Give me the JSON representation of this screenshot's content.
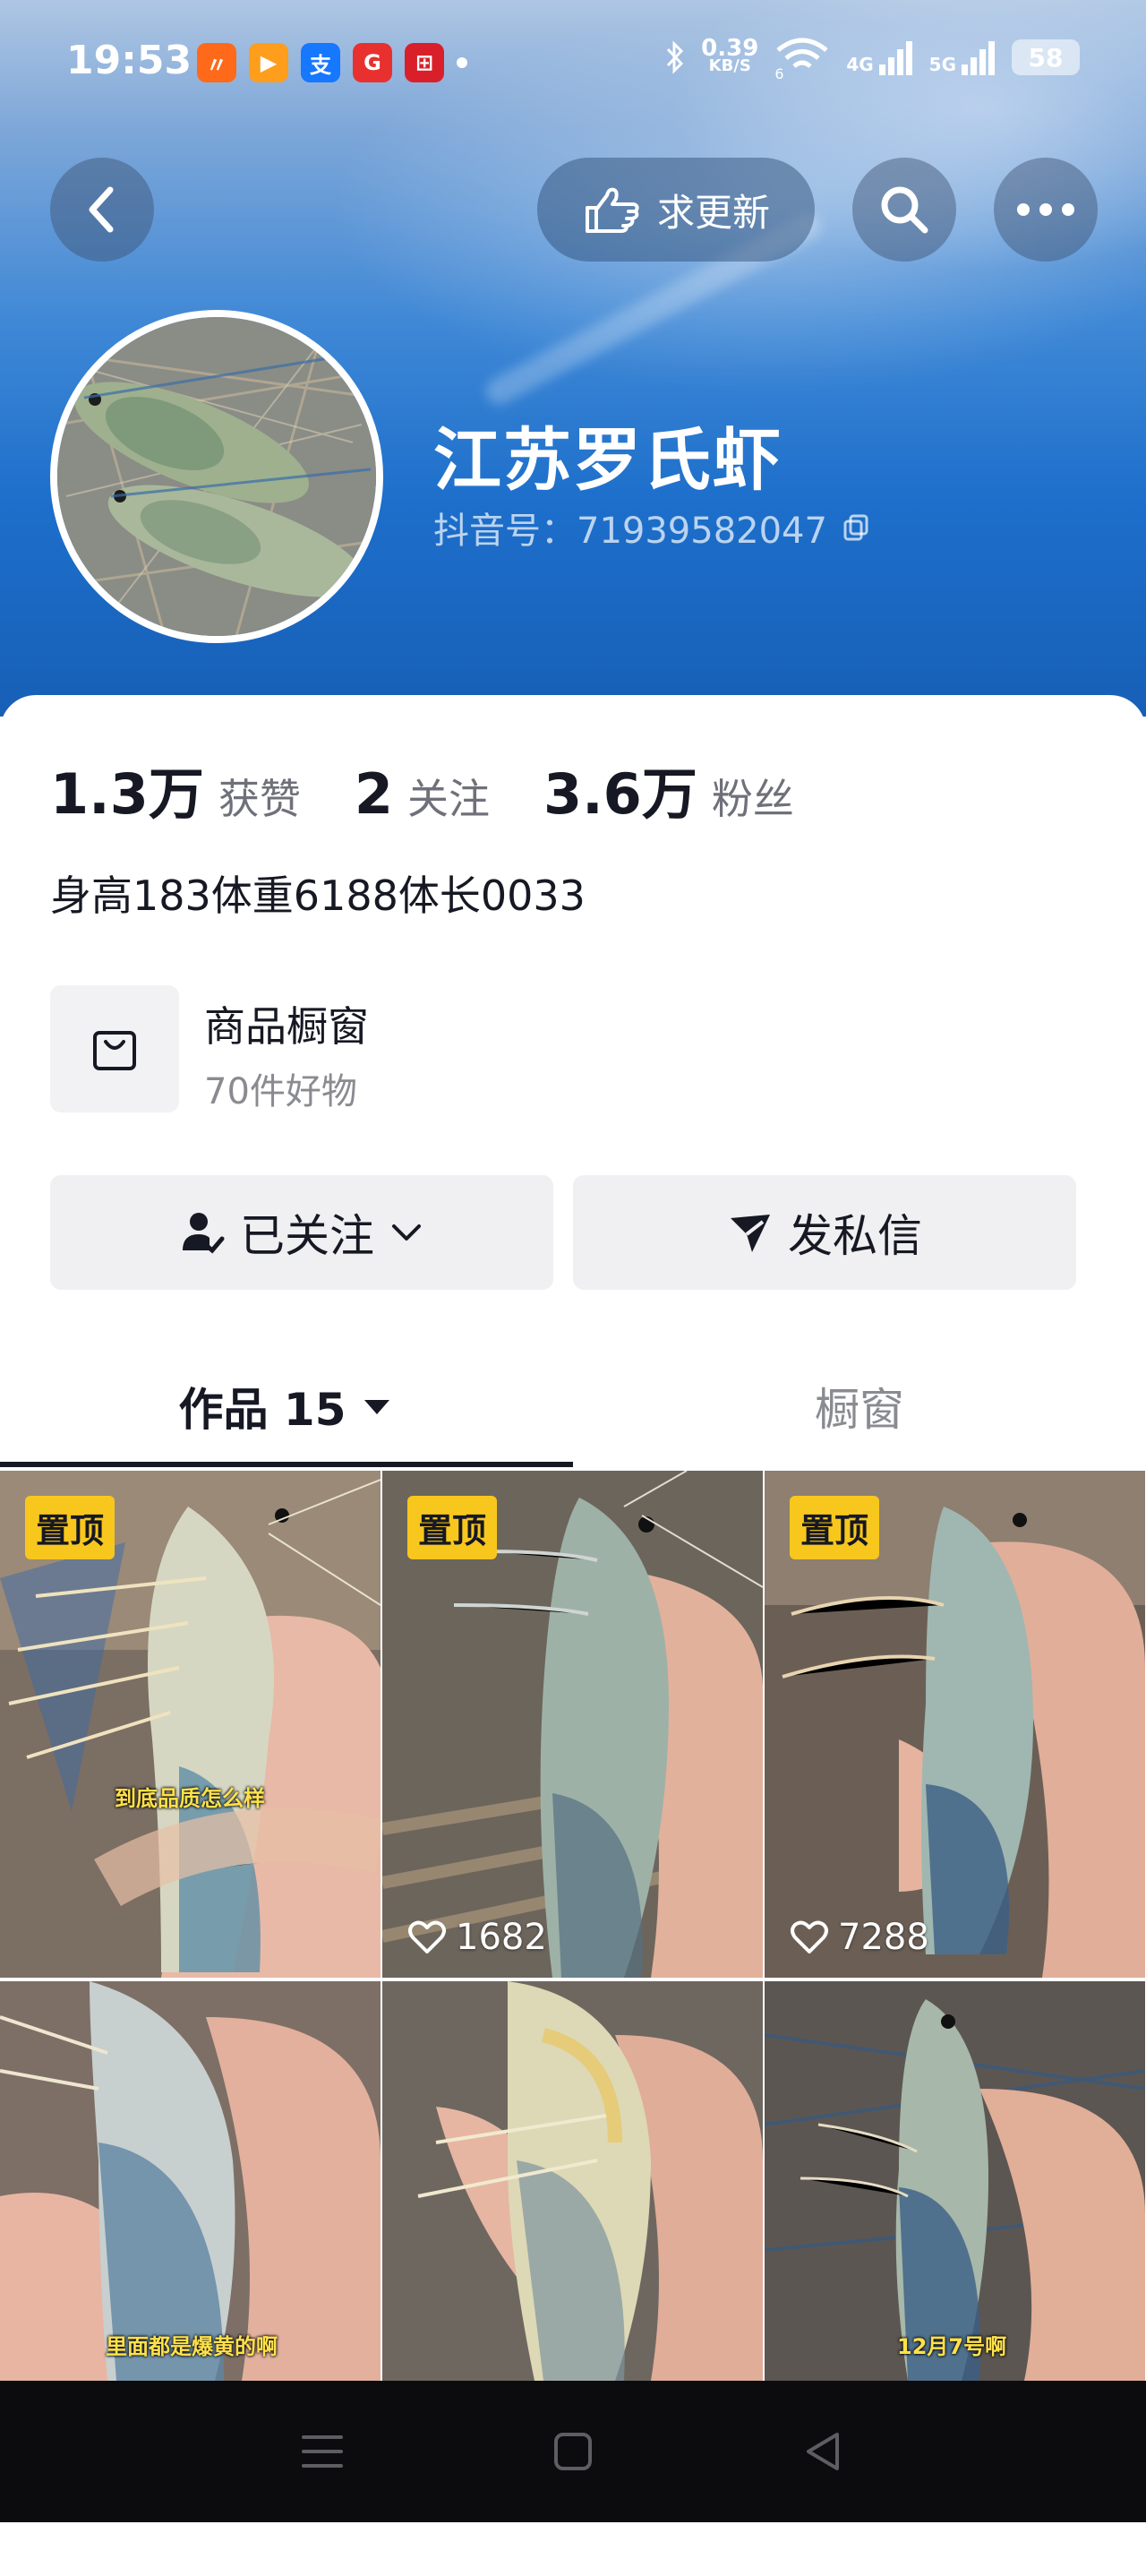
{
  "status_bar": {
    "time": "19:53",
    "net_speed_value": "0.39",
    "net_speed_unit": "KB/S",
    "wifi_label": "6",
    "signal_1": "4G",
    "signal_2": "5G",
    "battery": "58"
  },
  "header": {
    "request_update_label": "求更新",
    "account_name": "江苏罗氏虾",
    "douyin_id": "抖音号：71939582047"
  },
  "stats": {
    "likes_value": "1.3万",
    "likes_label": "获赞",
    "following_value": "2",
    "following_label": "关注",
    "followers_value": "3.6万",
    "followers_label": "粉丝"
  },
  "bio": "身高183体重6188体长0033",
  "shop": {
    "title": "商品橱窗",
    "subtitle": "70件好物"
  },
  "actions": {
    "follow_label": "已关注",
    "message_label": "发私信"
  },
  "tabs": {
    "works_label": "作品 15",
    "shop_label": "橱窗"
  },
  "videos": [
    {
      "pinned": "置顶",
      "caption": "到底品质怎么样",
      "likes": ""
    },
    {
      "pinned": "置顶",
      "caption": "",
      "likes": "1682"
    },
    {
      "pinned": "置顶",
      "caption": "",
      "likes": "7288"
    },
    {
      "pinned": "",
      "caption": "里面都是爆黄的啊",
      "likes": ""
    },
    {
      "pinned": "",
      "caption": "",
      "likes": ""
    },
    {
      "pinned": "",
      "caption": "12月7号啊",
      "likes": ""
    }
  ],
  "colors": {
    "header_blue": "#1d6fcb",
    "pin_badge": "#f8c71d",
    "text_primary": "#161823",
    "text_secondary": "#8a8b91"
  }
}
